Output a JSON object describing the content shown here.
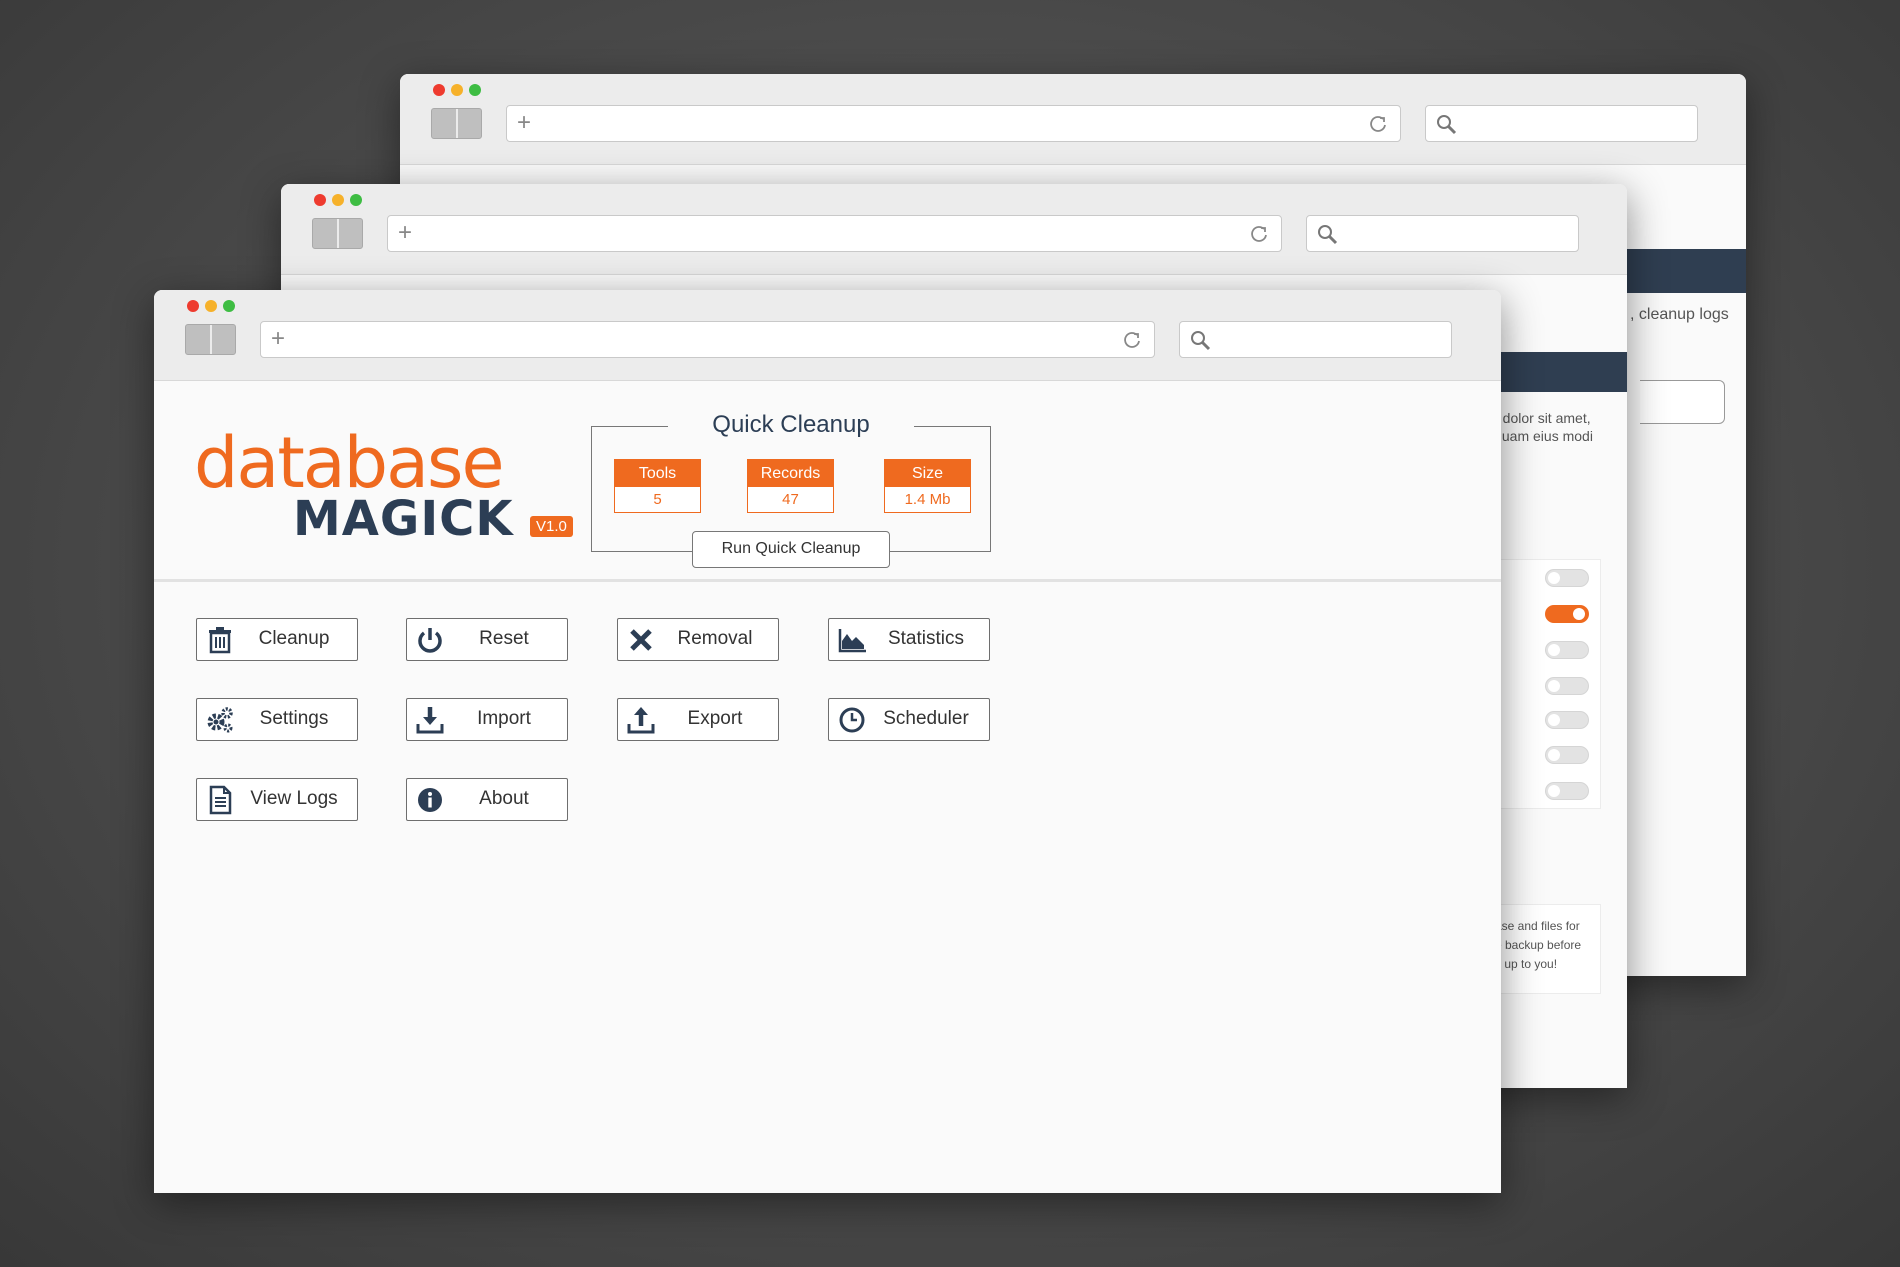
{
  "back_windows": {
    "partial_text_top": ", cleanup logs",
    "partial_text_mid_1": "a  dolor  sit  amet,",
    "partial_text_mid_2": "iquam  eius  modi",
    "partial_note_1": "ase and files for",
    "partial_note_2": "e backup before",
    "partial_note_3": "s up to you!",
    "toggles": [
      false,
      true,
      false,
      false,
      false,
      false,
      false
    ]
  },
  "logo": {
    "word_top": "database",
    "word_bottom": "MAGICK",
    "version": "V1.0"
  },
  "quick_cleanup": {
    "title": "Quick Cleanup",
    "stats": [
      {
        "label": "Tools",
        "value": "5"
      },
      {
        "label": "Records",
        "value": "47"
      },
      {
        "label": "Size",
        "value": "1.4 Mb"
      }
    ],
    "run_label": "Run Quick Cleanup"
  },
  "actions": [
    {
      "label": "Cleanup",
      "icon": "trash-icon"
    },
    {
      "label": "Reset",
      "icon": "power-icon"
    },
    {
      "label": "Removal",
      "icon": "x-icon"
    },
    {
      "label": "Statistics",
      "icon": "area-chart-icon"
    },
    {
      "label": "Settings",
      "icon": "gears-icon"
    },
    {
      "label": "Import",
      "icon": "download-icon"
    },
    {
      "label": "Export",
      "icon": "upload-icon"
    },
    {
      "label": "Scheduler",
      "icon": "clock-icon"
    },
    {
      "label": "View Logs",
      "icon": "document-icon"
    },
    {
      "label": "About",
      "icon": "info-icon"
    }
  ],
  "colors": {
    "accent": "#ef6a1f",
    "navy": "#2c3e55"
  }
}
